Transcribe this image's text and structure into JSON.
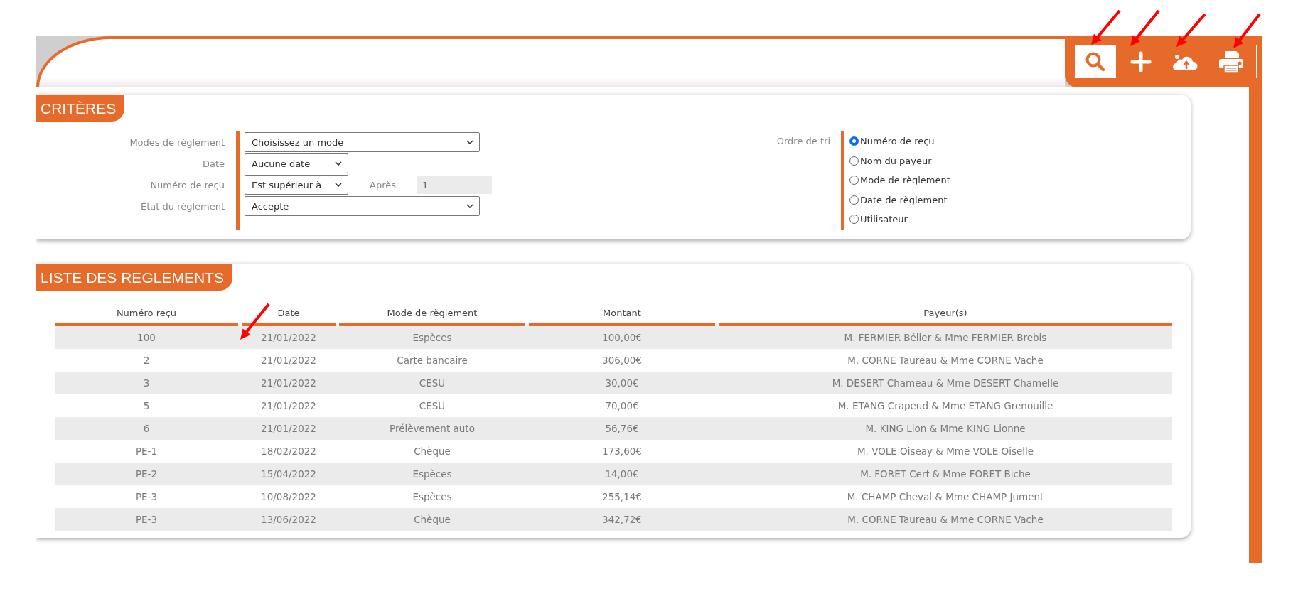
{
  "toolbar": [
    {
      "kind": "search",
      "selected": true
    },
    {
      "kind": "add",
      "selected": false
    },
    {
      "kind": "upload",
      "selected": false
    },
    {
      "kind": "print",
      "selected": false
    }
  ],
  "criteria": {
    "title": "CRITÈRES",
    "fields": [
      {
        "label": "Modes de règlement",
        "kind": "wide-select",
        "value": "Choisissez un mode"
      },
      {
        "label": "Date",
        "kind": "narrow-select",
        "value": "Aucune date"
      },
      {
        "label": "Numéro de reçu",
        "kind": "narrow-select",
        "value": "Est supérieur à",
        "extra": {
          "label": "Après",
          "value": "1"
        }
      },
      {
        "label": "État du règlement",
        "kind": "wide-select",
        "value": "Accepté"
      }
    ],
    "sort": {
      "label": "Ordre de tri",
      "options": [
        {
          "label": "Numéro de reçu",
          "selected": true
        },
        {
          "label": "Nom du payeur",
          "selected": false
        },
        {
          "label": "Mode de règlement",
          "selected": false
        },
        {
          "label": "Date de règlement",
          "selected": false
        },
        {
          "label": "Utilisateur",
          "selected": false
        }
      ]
    }
  },
  "list": {
    "title": "LISTE DES REGLEMENTS",
    "columns": [
      "Numéro reçu",
      "Date",
      "Mode de règlement",
      "Montant",
      "Payeur(s)"
    ],
    "rows": [
      [
        "100",
        "21/01/2022",
        "Espèces",
        "100,00€",
        "M. FERMIER Bélier & Mme FERMIER Brebis"
      ],
      [
        "2",
        "21/01/2022",
        "Carte bancaire",
        "306,00€",
        "M. CORNE Taureau & Mme CORNE Vache"
      ],
      [
        "3",
        "21/01/2022",
        "CESU",
        "30,00€",
        "M. DESERT Chameau & Mme DESERT Chamelle"
      ],
      [
        "5",
        "21/01/2022",
        "CESU",
        "70,00€",
        "M. ETANG Crapeud & Mme ETANG Grenouille"
      ],
      [
        "6",
        "21/01/2022",
        "Prélèvement auto",
        "56,76€",
        "M. KING Lion & Mme KING Lionne"
      ],
      [
        "PE-1",
        "18/02/2022",
        "Chèque",
        "173,60€",
        "M. VOLE Oiseay & Mme VOLE Oiselle"
      ],
      [
        "PE-2",
        "15/04/2022",
        "Espèces",
        "14,00€",
        "M. FORET Cerf & Mme FORET Biche"
      ],
      [
        "PE-3",
        "10/08/2022",
        "Espèces",
        "255,14€",
        "M. CHAMP Cheval & Mme CHAMP Jument"
      ],
      [
        "PE-3",
        "13/06/2022",
        "Chèque",
        "342,72€",
        "M. CORNE Taureau & Mme CORNE Vache"
      ]
    ]
  }
}
